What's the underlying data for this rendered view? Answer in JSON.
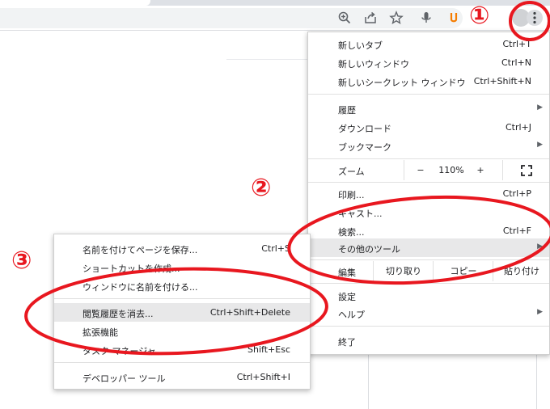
{
  "toolbar": {
    "icons": [
      "zoom-icon",
      "share-icon",
      "bookmark-star-icon",
      "mic-icon",
      "extension-icon",
      "profile-avatar",
      "menu-kebab-icon"
    ]
  },
  "main_menu": {
    "items": [
      {
        "label": "新しいタブ",
        "shortcut": "Ctrl+T"
      },
      {
        "label": "新しいウィンドウ",
        "shortcut": "Ctrl+N"
      },
      {
        "label": "新しいシークレット ウィンドウ",
        "shortcut": "Ctrl+Shift+N"
      },
      {
        "label": "履歴",
        "shortcut": ""
      },
      {
        "label": "ダウンロード",
        "shortcut": "Ctrl+J"
      },
      {
        "label": "ブックマーク",
        "shortcut": ""
      },
      {
        "label": "印刷...",
        "shortcut": "Ctrl+P"
      },
      {
        "label": "キャスト...",
        "shortcut": ""
      },
      {
        "label": "検索...",
        "shortcut": "Ctrl+F"
      },
      {
        "label": "その他のツール",
        "shortcut": ""
      },
      {
        "label": "設定",
        "shortcut": ""
      },
      {
        "label": "ヘルプ",
        "shortcut": ""
      },
      {
        "label": "終了",
        "shortcut": ""
      }
    ],
    "zoom": {
      "label": "ズーム",
      "minus": "−",
      "value": "110%",
      "plus": "+"
    },
    "edit": {
      "label": "編集",
      "cut": "切り取り",
      "copy": "コピー",
      "paste": "貼り付け"
    }
  },
  "sub_menu": {
    "items": [
      {
        "label": "名前を付けてページを保存...",
        "shortcut": "Ctrl+S"
      },
      {
        "label": "ショートカットを作成...",
        "shortcut": ""
      },
      {
        "label": "ウィンドウに名前を付ける...",
        "shortcut": ""
      },
      {
        "label": "閲覧履歴を消去...",
        "shortcut": "Ctrl+Shift+Delete"
      },
      {
        "label": "拡張機能",
        "shortcut": ""
      },
      {
        "label": "タスク マネージャ",
        "shortcut": "Shift+Esc"
      },
      {
        "label": "デベロッパー ツール",
        "shortcut": "Ctrl+Shift+I"
      }
    ]
  },
  "annotations": {
    "step1": "①",
    "step2": "②",
    "step3": "③",
    "color": "#e8171f"
  },
  "colors": {
    "menu_highlight": "#e8e8e9",
    "toolbar_bg": "#f1f3f4"
  }
}
